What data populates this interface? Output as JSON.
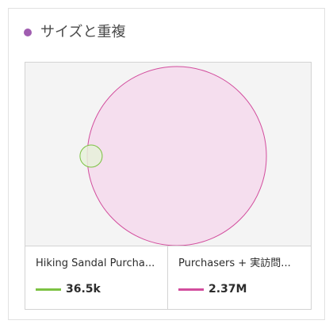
{
  "card": {
    "title": "サイズと重複",
    "dot_color": "#a05db0"
  },
  "chart_data": {
    "type": "venn",
    "sets": [
      {
        "name": "Hiking Sandal Purcha...",
        "value_label": "36.5k",
        "value": 36500,
        "color": "#7cc243",
        "fill": "#e6f1d9"
      },
      {
        "name": "Purchasers + 実訪問...",
        "value_label": "2.37M",
        "value": 2370000,
        "color": "#d24d9d",
        "fill": "#f5d9ec"
      }
    ]
  }
}
